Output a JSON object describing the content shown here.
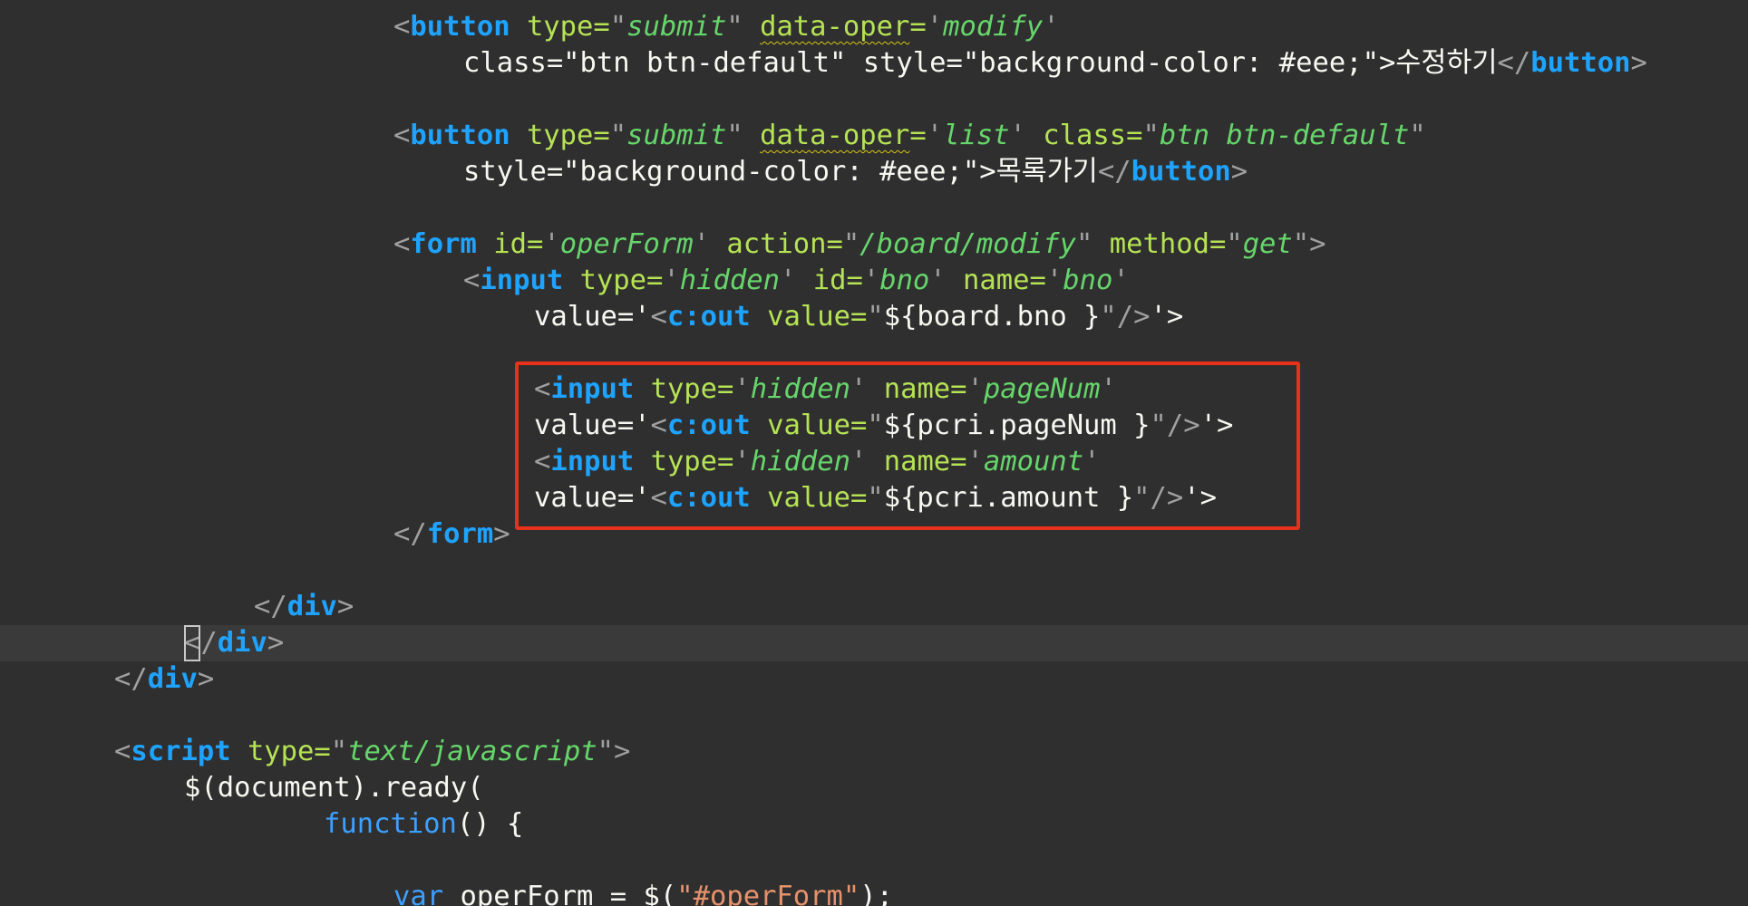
{
  "editor": {
    "highlight": "red-annotation-box",
    "colors": {
      "background": "#2f2f2f",
      "tag": "#1ea3ff",
      "attribute": "#b6e354",
      "string": "#66d66b",
      "punctuation": "#a0a0a0",
      "text": "#f8f8f2",
      "annotation": "#e8311a"
    },
    "lines": [
      "<button type=\"submit\" data-oper='modify'",
      "class=\"btn btn-default\" style=\"background-color: #eee;\">수정하기</button>",
      "",
      "<button type=\"submit\" data-oper='list' class=\"btn btn-default\"",
      "style=\"background-color: #eee;\">목록가기</button>",
      "",
      "<form id='operForm' action=\"/board/modify\" method=\"get\">",
      "<input type='hidden' id='bno' name='bno'",
      "value='<c:out value=\"${board.bno }\"/>'>",
      "",
      "<input type='hidden' name='pageNum'",
      "value='<c:out value=\"${pcri.pageNum }\"/>'>",
      "<input type='hidden' name='amount'",
      "value='<c:out value=\"${pcri.amount }\"/>'>",
      "</form>",
      "",
      "</div>",
      "</div>",
      "</div>",
      "",
      "<script type=\"text/javascript\">",
      "$(document).ready(",
      "function() {",
      "",
      "var operForm = $(\"#operForm\");"
    ]
  }
}
